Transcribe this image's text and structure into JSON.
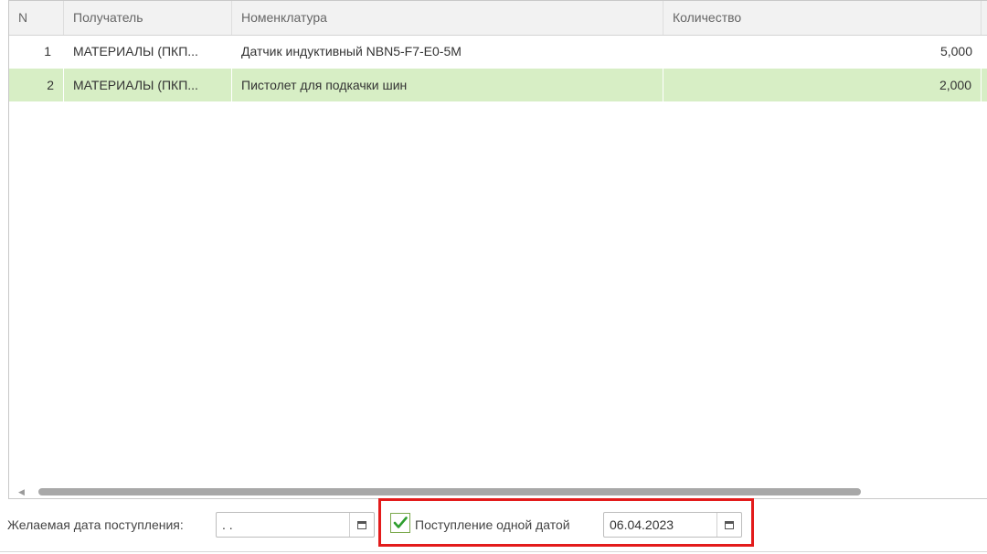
{
  "table": {
    "columns": [
      "N",
      "Получатель",
      "Номенклатура",
      "Количество"
    ],
    "rows": [
      {
        "n": "1",
        "recipient": "МАТЕРИАЛЫ (ПКП...",
        "item": "Датчик индуктивный NBN5-F7-E0-5M",
        "qty": "5,000",
        "selected": false
      },
      {
        "n": "2",
        "recipient": "МАТЕРИАЛЫ (ПКП...",
        "item": "Пистолет для подкачки шин",
        "qty": "2,000",
        "selected": true
      }
    ]
  },
  "footer": {
    "desired_date_label": "Желаемая дата поступления:",
    "desired_date_value": " .  .",
    "one_date_checkbox_label": "Поступление одной датой",
    "one_date_checked": true,
    "one_date_value": "06.04.2023"
  },
  "colors": {
    "selected_row": "#d7eec5",
    "highlight_border": "#e31b1b",
    "checkmark": "#2e9e2e"
  }
}
